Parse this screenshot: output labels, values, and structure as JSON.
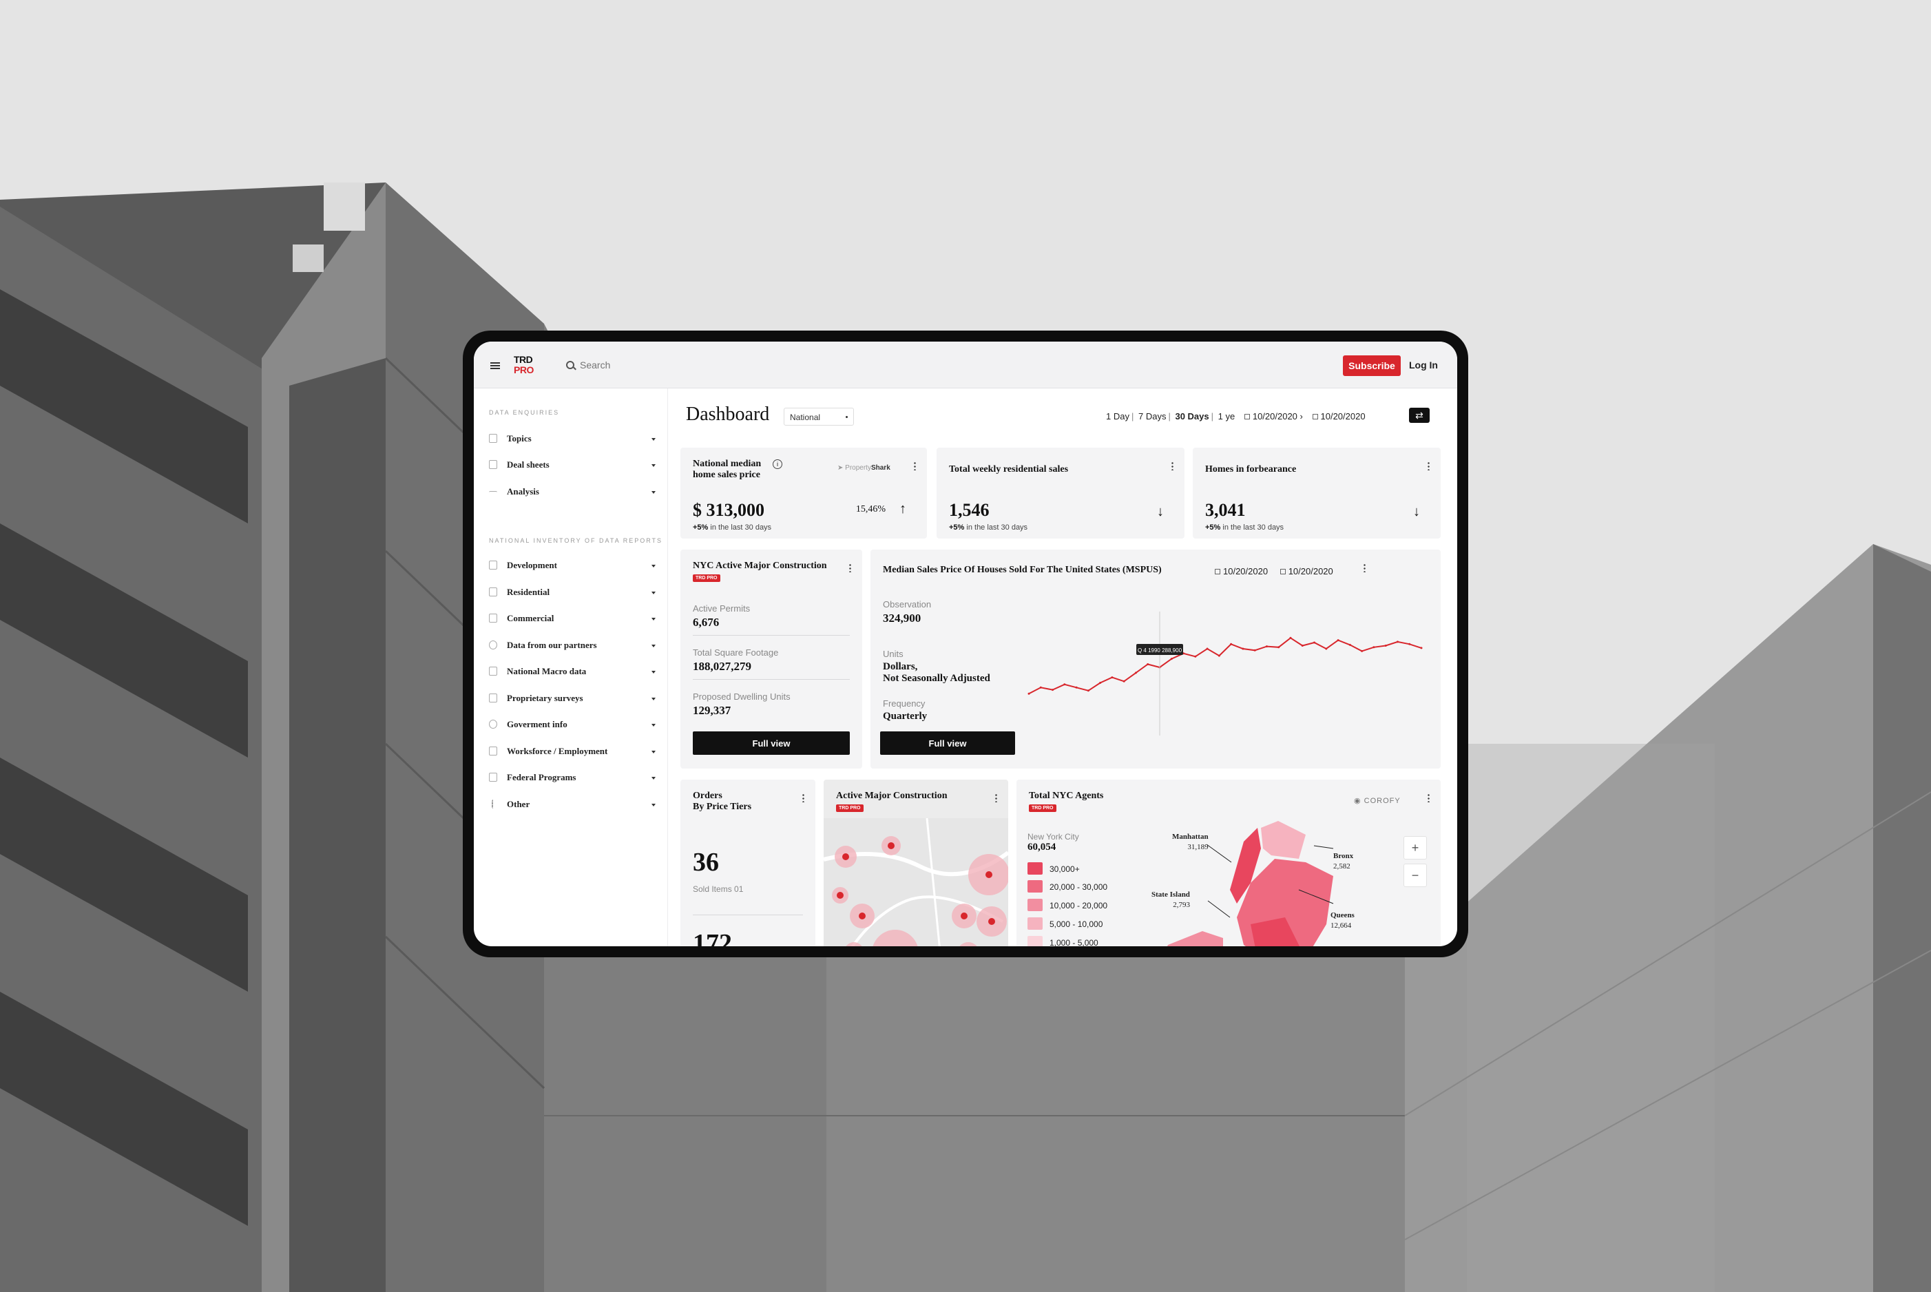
{
  "brand": {
    "accent": "#d8262c",
    "ink": "#111111",
    "logo_line1": "TRD",
    "logo_line2": "PRO"
  },
  "topbar": {
    "search_placeholder": "Search",
    "subscribe_label": "Subscribe",
    "login_label": "Log In"
  },
  "sidebar": {
    "section1_title": "DATA ENQUIRIES",
    "section1_items": [
      {
        "label": "Topics",
        "icon": "document-icon"
      },
      {
        "label": "Deal sheets",
        "icon": "sheet-icon"
      },
      {
        "label": "Analysis",
        "icon": "pulse-icon"
      }
    ],
    "section2_title": "NATIONAL INVENTORY OF DATA REPORTS",
    "section2_items": [
      {
        "label": "Development",
        "icon": "box-icon"
      },
      {
        "label": "Residential",
        "icon": "home-icon"
      },
      {
        "label": "Commercial",
        "icon": "store-icon"
      },
      {
        "label": "Data from our partners",
        "icon": "users-icon"
      },
      {
        "label": "National Macro data",
        "icon": "file-icon"
      },
      {
        "label": "Proprietary surveys",
        "icon": "survey-icon"
      },
      {
        "label": "Goverment info",
        "icon": "info-icon"
      },
      {
        "label": "Worksforce / Employment",
        "icon": "briefcase-icon"
      },
      {
        "label": "Federal Programs",
        "icon": "building-icon"
      },
      {
        "label": "Other",
        "icon": "more-icon"
      }
    ]
  },
  "header": {
    "title": "Dashboard",
    "region": "National",
    "ranges": [
      "1 Day",
      "7 Days",
      "30 Days",
      "1 ye"
    ],
    "active_range": "30 Days",
    "date_from": "10/20/2020",
    "date_to": "10/20/2020"
  },
  "kpi_cards": [
    {
      "title_line1": "National median",
      "title_line2": "home sales price",
      "value": "$ 313,000",
      "delta_strong": "+5%",
      "delta_text": "in the last 30 days",
      "rate": "15,46%",
      "partner_prefix": "Property",
      "partner_name": "Shark"
    },
    {
      "title": "Total weekly residential sales",
      "value": "1,546",
      "delta_strong": "+5%",
      "delta_text": "in the last 30 days"
    },
    {
      "title": "Homes in forbearance",
      "value": "3,041",
      "delta_strong": "+5%",
      "delta_text": "in the last 30 days"
    }
  ],
  "construction_card": {
    "title": "NYC Active Major Construction",
    "tag": "TRD PRO",
    "metrics": [
      {
        "label": "Active Permits",
        "value": "6,676"
      },
      {
        "label": "Total Square Footage",
        "value": "188,027,279"
      },
      {
        "label": "Proposed Dwelling Units",
        "value": "129,337"
      }
    ],
    "button_label": "Full view"
  },
  "mspus_card": {
    "title": "Median Sales Price Of Houses Sold For The United States (MSPUS)",
    "date_from": "10/20/2020",
    "date_to": "10/20/2020",
    "observation_label": "Observation",
    "observation_value": "324,900",
    "units_label": "Units",
    "units_value_line1": "Dollars,",
    "units_value_line2": "Not Seasonally Adjusted",
    "frequency_label": "Frequency",
    "frequency_value": "Quarterly",
    "button_label": "Full view"
  },
  "chart_data": {
    "type": "line",
    "title": "",
    "xlabel": "",
    "ylabel": "",
    "series": [
      {
        "name": "",
        "color": "#d8262c",
        "values": [
          254,
          262,
          259,
          266,
          262,
          258,
          268,
          275,
          270,
          281,
          292,
          288,
          299,
          306,
          302,
          312,
          303,
          318,
          312,
          310,
          315,
          314,
          326,
          316,
          320,
          312,
          323,
          317,
          309,
          314,
          316,
          321,
          318,
          313
        ]
      }
    ],
    "tooltip": "Q 4 1990 288,900",
    "ylim": [
      200,
      360
    ],
    "grid": false
  },
  "orders_card": {
    "title_line1": "Orders",
    "title_line2": "By Price Tiers",
    "value1": "36",
    "label1": "Sold Items 01",
    "value2": "172"
  },
  "active_construction_card": {
    "title": "Active Major Construction",
    "tag": "TRD PRO"
  },
  "agents_card": {
    "title": "Total NYC Agents",
    "tag": "TRD PRO",
    "partner": "COROFY",
    "city_label": "New York City",
    "city_value": "60,054",
    "legend": [
      {
        "label": "30,000+",
        "color": "#e8465e"
      },
      {
        "label": "20,000 - 30,000",
        "color": "#ee6a80"
      },
      {
        "label": "10,000 - 20,000",
        "color": "#f28ea0"
      },
      {
        "label": "5,000 - 10,000",
        "color": "#f6b3bf"
      },
      {
        "label": "1,000 - 5,000",
        "color": "#fad3da"
      }
    ],
    "boroughs": [
      {
        "name": "Manhattan",
        "value": "31,189"
      },
      {
        "name": "Bronx",
        "value": "2,582"
      },
      {
        "name": "State Island",
        "value": "2,793"
      },
      {
        "name": "Queens",
        "value": "12,664"
      }
    ],
    "zoom_in": "+",
    "zoom_out": "−"
  }
}
